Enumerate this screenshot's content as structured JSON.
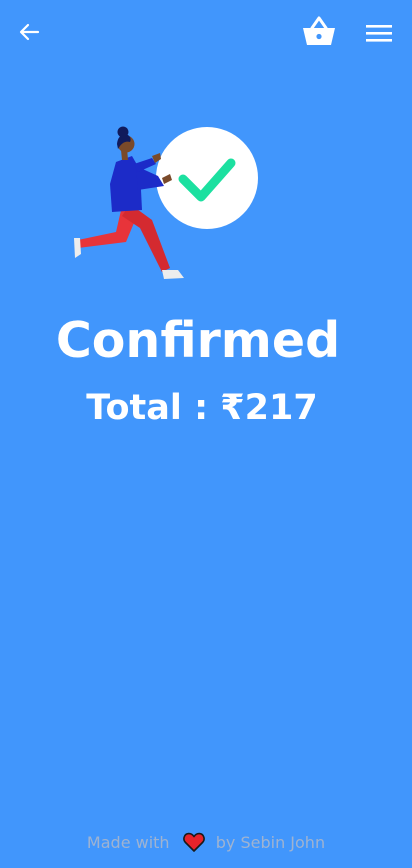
{
  "header": {
    "back_icon": "arrow-left-icon",
    "basket_icon": "shopping-basket-icon",
    "menu_icon": "hamburger-menu-icon"
  },
  "confirmation": {
    "title": "Confirmed",
    "total_label": "Total :",
    "total_amount": "₹217",
    "check_color": "#1CE0A0"
  },
  "footer": {
    "made_with": "Made with",
    "heart_icon": "heart-icon",
    "by_text": "by Sebin John"
  },
  "colors": {
    "background": "#4196FC",
    "text": "#FFFFFF",
    "footer_text": "#9FB3D1",
    "heart": "#E8232A"
  }
}
